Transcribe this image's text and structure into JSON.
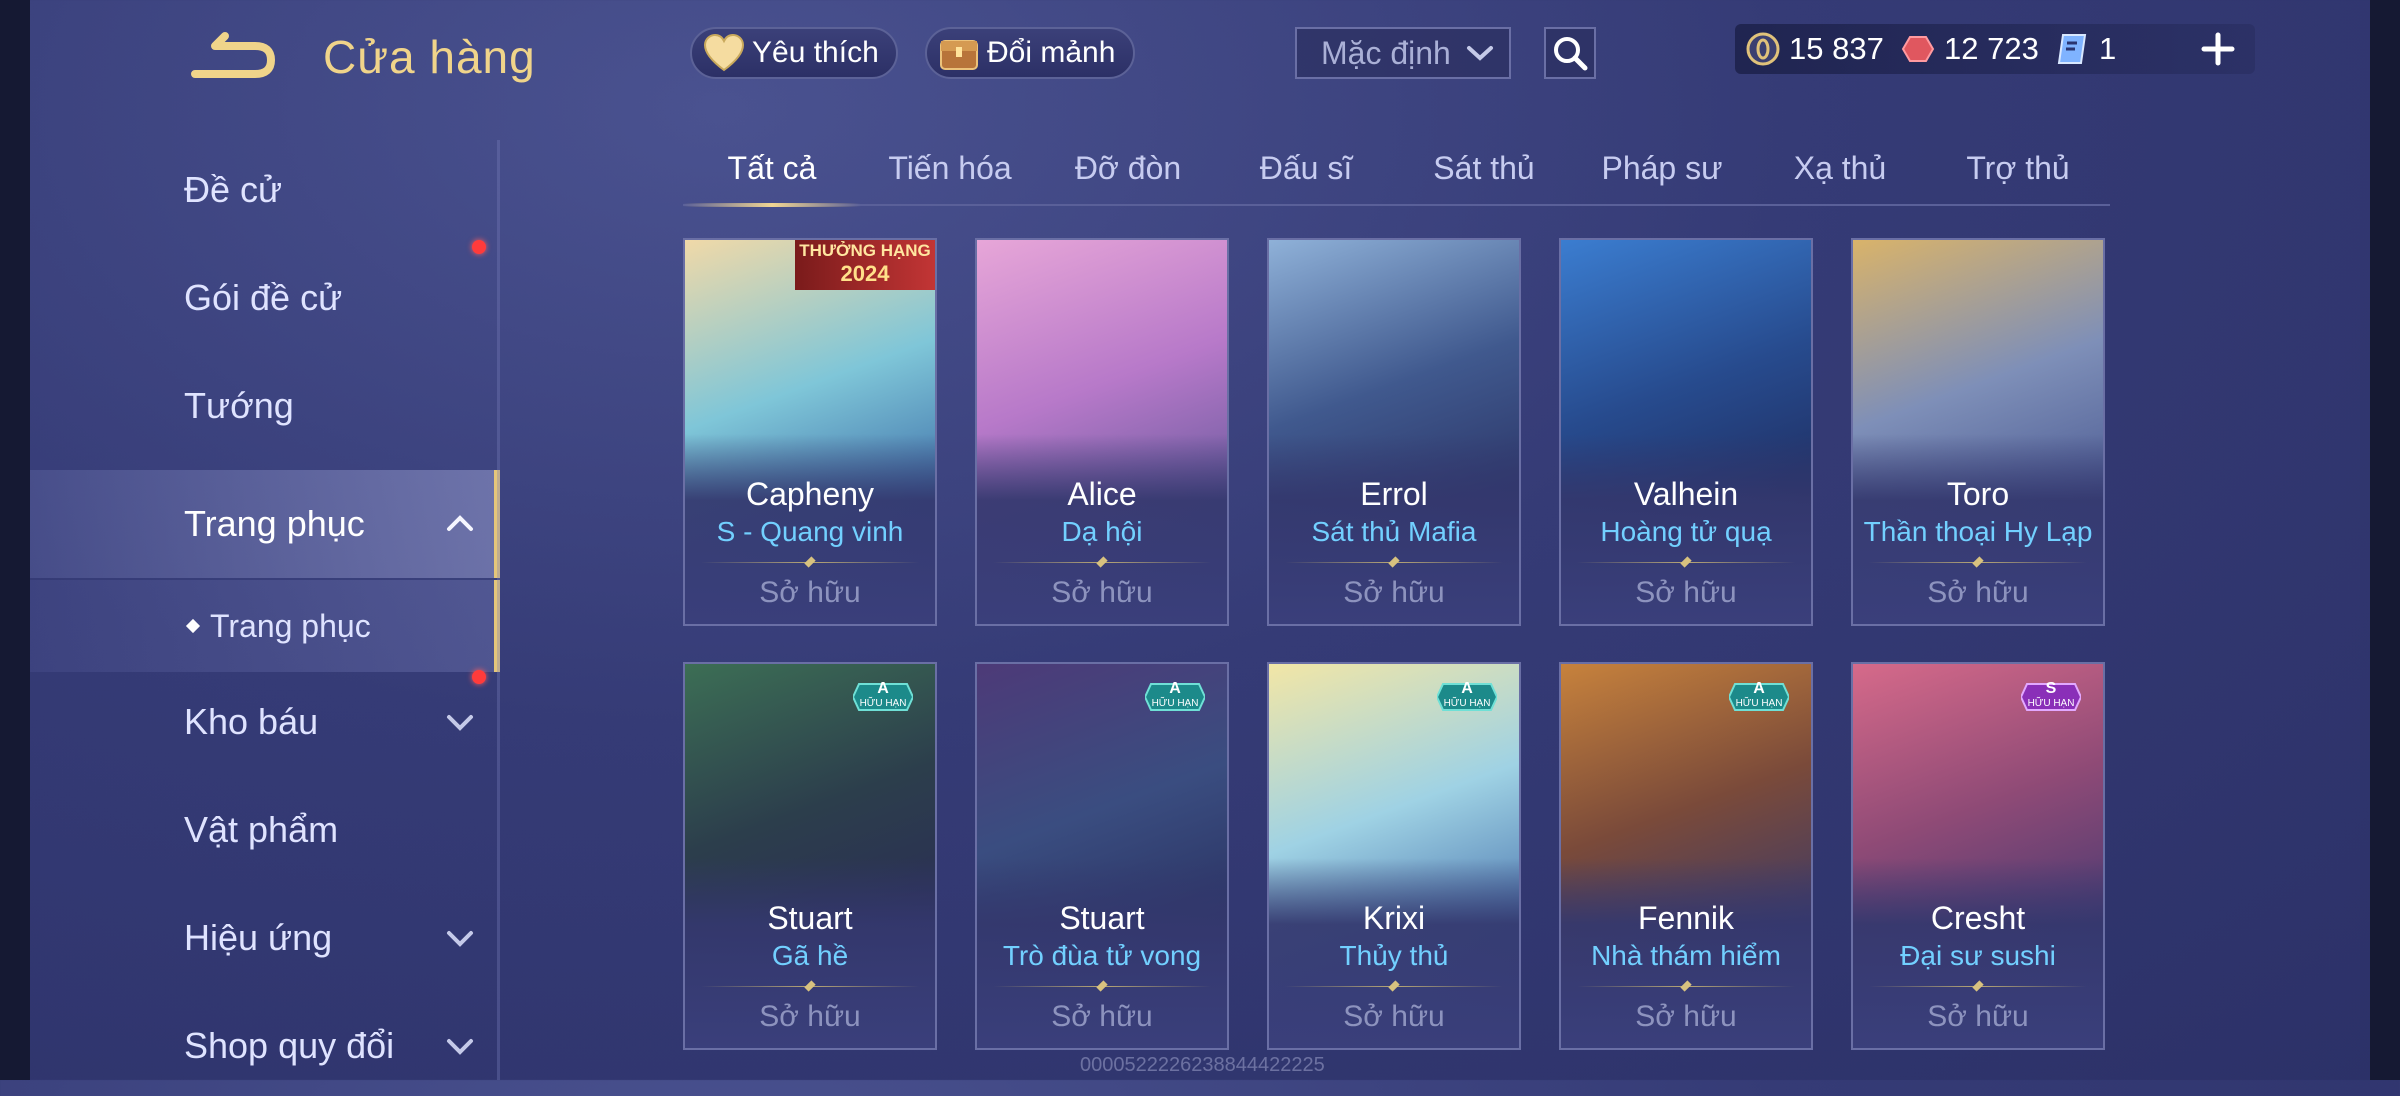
{
  "header": {
    "title": "Cửa hàng",
    "favorite_label": "Yêu thích",
    "fragment_label": "Đổi mảnh",
    "sort_value": "Mặc định"
  },
  "currency": [
    {
      "icon": "gold-coin-icon",
      "value": "15 837",
      "color": "#e0c27a"
    },
    {
      "icon": "red-gem-icon",
      "value": "12 723",
      "color": "#e0575f"
    },
    {
      "icon": "blue-voucher-icon",
      "value": "1",
      "color": "#7fb3ff"
    }
  ],
  "sidebar": {
    "items": [
      {
        "label": "Đề cử"
      },
      {
        "label": "Gói đề cử"
      },
      {
        "label": "Tướng"
      },
      {
        "label": "Trang phục"
      },
      {
        "label": "Trang phục"
      },
      {
        "label": "Kho báu"
      },
      {
        "label": "Vật phẩm"
      },
      {
        "label": "Hiệu ứng"
      },
      {
        "label": "Shop quy đổi"
      }
    ]
  },
  "tabs": [
    "Tất cả",
    "Tiến hóa",
    "Đỡ đòn",
    "Đấu sĩ",
    "Sát thủ",
    "Pháp sư",
    "Xạ thủ",
    "Trợ thủ"
  ],
  "cards": [
    {
      "hero": "Capheny",
      "skin": "S - Quang vinh",
      "status": "Sở hữu",
      "badge_top": "THƯỞNG HẠNG",
      "badge_bottom": "2024"
    },
    {
      "hero": "Alice",
      "skin": "Dạ hội",
      "status": "Sở hữu"
    },
    {
      "hero": "Errol",
      "skin": "Sát thủ Mafia",
      "status": "Sở hữu"
    },
    {
      "hero": "Valhein",
      "skin": "Hoàng tử quạ",
      "status": "Sở hữu"
    },
    {
      "hero": "Toro",
      "skin": "Thần thoại Hy Lạp",
      "status": "Sở hữu"
    },
    {
      "hero": "Stuart",
      "skin": "Gã hề",
      "status": "Sở hữu",
      "tier": "A",
      "tier_sub": "HỮU HẠN"
    },
    {
      "hero": "Stuart",
      "skin": "Trò đùa tử vong",
      "status": "Sở hữu",
      "tier": "A",
      "tier_sub": "HỮU HẠN"
    },
    {
      "hero": "Krixi",
      "skin": "Thủy thủ",
      "status": "Sở hữu",
      "tier": "A",
      "tier_sub": "HỮU HẠN"
    },
    {
      "hero": "Fennik",
      "skin": "Nhà thám hiểm",
      "status": "Sở hữu",
      "tier": "A",
      "tier_sub": "HỮU HẠN"
    },
    {
      "hero": "Cresht",
      "skin": "Đại sư sushi",
      "status": "Sở hữu",
      "tier": "S",
      "tier_sub": "HỮU HẠN"
    }
  ],
  "watermark": "0000522226238844422225",
  "colors": {
    "accent_gold": "#f0d48a",
    "skin_name": "#72d0ff",
    "notification": "#ff3b3b"
  }
}
